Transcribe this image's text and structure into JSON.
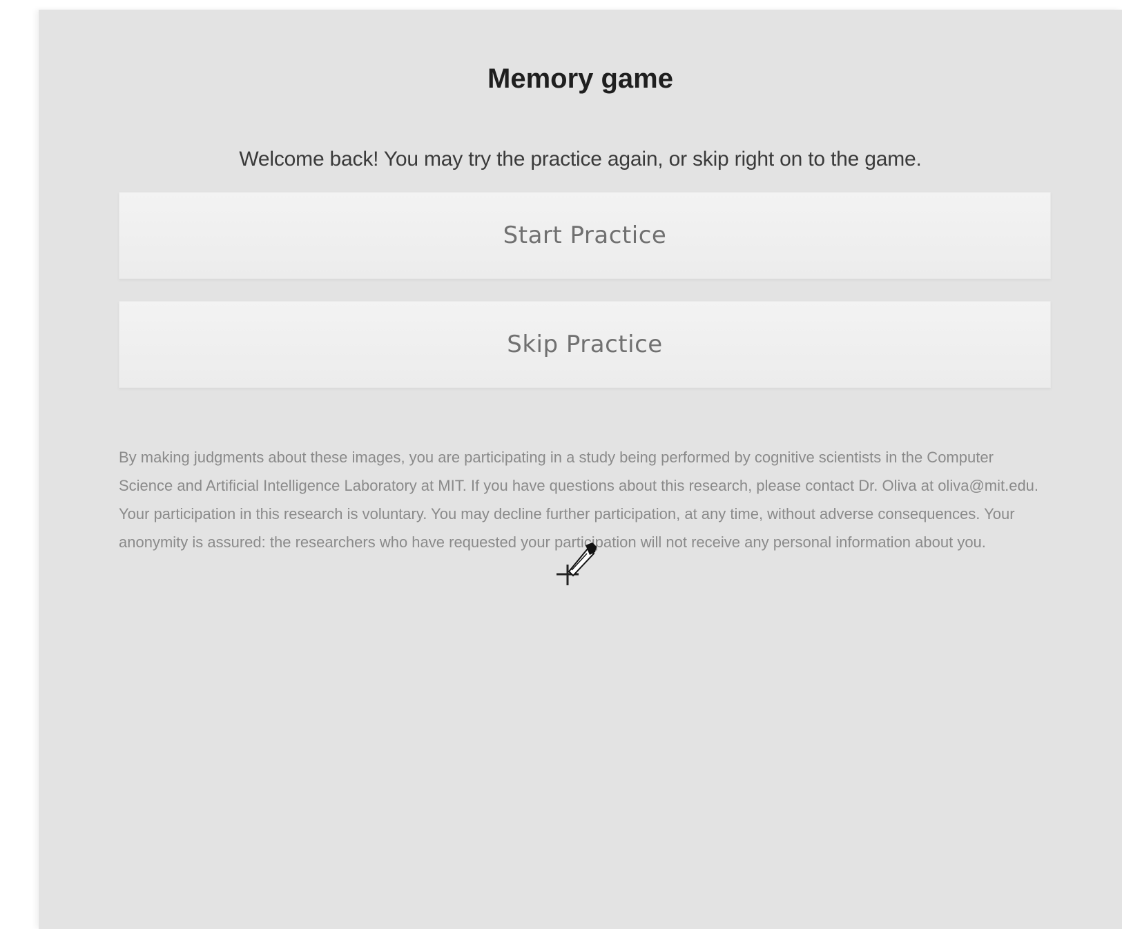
{
  "page": {
    "title": "Memory game",
    "welcome": "Welcome back! You may try the practice again, or skip right on to the game.",
    "buttons": {
      "start_label": "Start Practice",
      "skip_label": "Skip Practice"
    },
    "consent": "By making judgments about these images, you are participating in a study being performed by cognitive scientists in the Computer Science and Artificial Intelligence Laboratory at MIT. If you have questions about this research, please contact Dr. Oliva at oliva@mit.edu. Your participation in this research is voluntary. You may decline further participation, at any time, without adverse consequences. Your anonymity is assured: the researchers who have requested your participation will not receive any personal information about you."
  },
  "cursor": {
    "icon": "eyedropper-cursor-icon"
  },
  "colors": {
    "panel_bg": "#e3e3e3",
    "button_bg": "#f0f0f0",
    "button_text": "#707070"
  }
}
